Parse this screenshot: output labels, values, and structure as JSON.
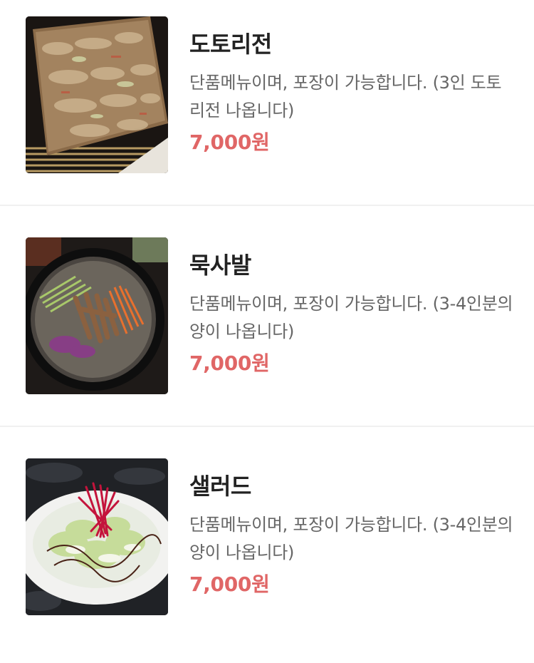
{
  "menu": {
    "items": [
      {
        "name": "도토리전",
        "desc": "단품메뉴이며, 포장이 가능합니다. (3인 도토리전 나옵니다)",
        "price": "7,000원",
        "image": "acorn-pancake-photo"
      },
      {
        "name": "묵사발",
        "desc": "단품메뉴이며, 포장이 가능합니다. (3-4인분의 양이 나옵니다)",
        "price": "7,000원",
        "image": "acorn-jelly-soup-photo"
      },
      {
        "name": "샐러드",
        "desc": "단품메뉴이며, 포장이 가능합니다. (3-4인분의 양이 나옵니다)",
        "price": "7,000원",
        "image": "salad-photo"
      }
    ]
  },
  "colors": {
    "price": "#e06666",
    "name": "#222222",
    "description": "#666666",
    "divider": "#f0f0f0"
  }
}
